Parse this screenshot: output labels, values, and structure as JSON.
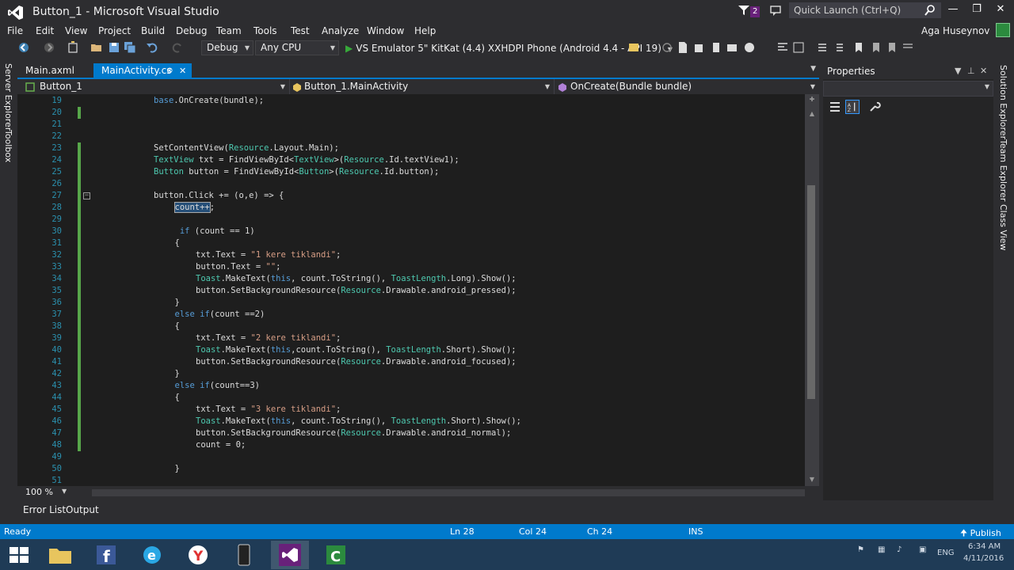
{
  "window": {
    "title": "Button_1 - Microsoft Visual Studio"
  },
  "titlebar": {
    "notification_count": "2",
    "quick_launch_placeholder": "Quick Launch (Ctrl+Q)"
  },
  "menu": {
    "items": [
      "File",
      "Edit",
      "View",
      "Project",
      "Build",
      "Debug",
      "Team",
      "Tools",
      "Test",
      "Analyze",
      "Window",
      "Help"
    ],
    "user": "Aga Huseynov"
  },
  "toolbar": {
    "config": "Debug",
    "platform": "Any CPU",
    "run_target": "VS Emulator 5\" KitKat (4.4) XXHDPI Phone (Android 4.4 - API 19)"
  },
  "side_tabs": {
    "left": [
      "Server Explorer",
      "Toolbox"
    ],
    "right": [
      "Solution Explorer",
      "Team Explorer",
      "Class View"
    ]
  },
  "tabs": [
    {
      "label": "Main.axml",
      "active": false
    },
    {
      "label": "MainActivity.cs",
      "active": true
    }
  ],
  "navbar": {
    "project": "Button_1",
    "type": "Button_1.MainActivity",
    "member": "OnCreate(Bundle bundle)"
  },
  "editor": {
    "lines": [
      {
        "n": "19",
        "code": "base.OnCreate(bundle);",
        "indent": 0
      },
      {
        "n": "20",
        "code": "",
        "indent": 0
      },
      {
        "n": "21",
        "code": "",
        "indent": 0
      },
      {
        "n": "22",
        "code": "",
        "indent": 0
      },
      {
        "n": "23",
        "code": "SetContentView(Resource.Layout.Main);",
        "indent": 0
      },
      {
        "n": "24",
        "code": "TextView txt = FindViewById<TextView>(Resource.Id.textView1);",
        "indent": 0
      },
      {
        "n": "25",
        "code": "Button button = FindViewById<Button>(Resource.Id.button);",
        "indent": 0
      },
      {
        "n": "26",
        "code": "",
        "indent": 0
      },
      {
        "n": "27",
        "code": "button.Click += (o,e) => {",
        "indent": 0
      },
      {
        "n": "28",
        "code": "count++;",
        "indent": 1
      },
      {
        "n": "29",
        "code": "",
        "indent": 0
      },
      {
        "n": "30",
        "code": " if (count == 1)",
        "indent": 1
      },
      {
        "n": "31",
        "code": "{",
        "indent": 1
      },
      {
        "n": "32",
        "code": "txt.Text = \"1 kere tiklandi\";",
        "indent": 2
      },
      {
        "n": "33",
        "code": "button.Text = \"\";",
        "indent": 2
      },
      {
        "n": "34",
        "code": "Toast.MakeText(this, count.ToString(), ToastLength.Long).Show();",
        "indent": 2
      },
      {
        "n": "35",
        "code": "button.SetBackgroundResource(Resource.Drawable.android_pressed);",
        "indent": 2
      },
      {
        "n": "36",
        "code": "}",
        "indent": 1
      },
      {
        "n": "37",
        "code": "else if(count ==2)",
        "indent": 1
      },
      {
        "n": "38",
        "code": "{",
        "indent": 1
      },
      {
        "n": "39",
        "code": "txt.Text = \"2 kere tiklandi\";",
        "indent": 2
      },
      {
        "n": "40",
        "code": "Toast.MakeText(this,count.ToString(), ToastLength.Short).Show();",
        "indent": 2
      },
      {
        "n": "41",
        "code": "button.SetBackgroundResource(Resource.Drawable.android_focused);",
        "indent": 2
      },
      {
        "n": "42",
        "code": "}",
        "indent": 1
      },
      {
        "n": "43",
        "code": "else if(count==3)",
        "indent": 1
      },
      {
        "n": "44",
        "code": "{",
        "indent": 1
      },
      {
        "n": "45",
        "code": "txt.Text = \"3 kere tiklandi\";",
        "indent": 2
      },
      {
        "n": "46",
        "code": "Toast.MakeText(this, count.ToString(), ToastLength.Short).Show();",
        "indent": 2
      },
      {
        "n": "47",
        "code": "button.SetBackgroundResource(Resource.Drawable.android_normal);",
        "indent": 2
      },
      {
        "n": "48",
        "code": "count = 0;",
        "indent": 2
      },
      {
        "n": "49",
        "code": "",
        "indent": 0
      },
      {
        "n": "50",
        "code": "}",
        "indent": 1
      },
      {
        "n": "51",
        "code": "",
        "indent": 0
      }
    ],
    "zoom": "100 %"
  },
  "bottom_tabs": [
    "Error List",
    "Output"
  ],
  "properties": {
    "title": "Properties"
  },
  "status": {
    "state": "Ready",
    "ln": "Ln 28",
    "col": "Col 24",
    "ch": "Ch 24",
    "mode": "INS",
    "publish": "Publish"
  },
  "taskbar": {
    "lang": "ENG",
    "time": "6:34 AM",
    "date": "4/11/2016"
  },
  "colors": {
    "accent": "#007acc",
    "background": "#2d2d30",
    "editor_bg": "#1e1e1e",
    "keyword": "#569cd6",
    "type": "#4ec9b0",
    "string": "#d69d85",
    "line_number": "#2b91af"
  }
}
